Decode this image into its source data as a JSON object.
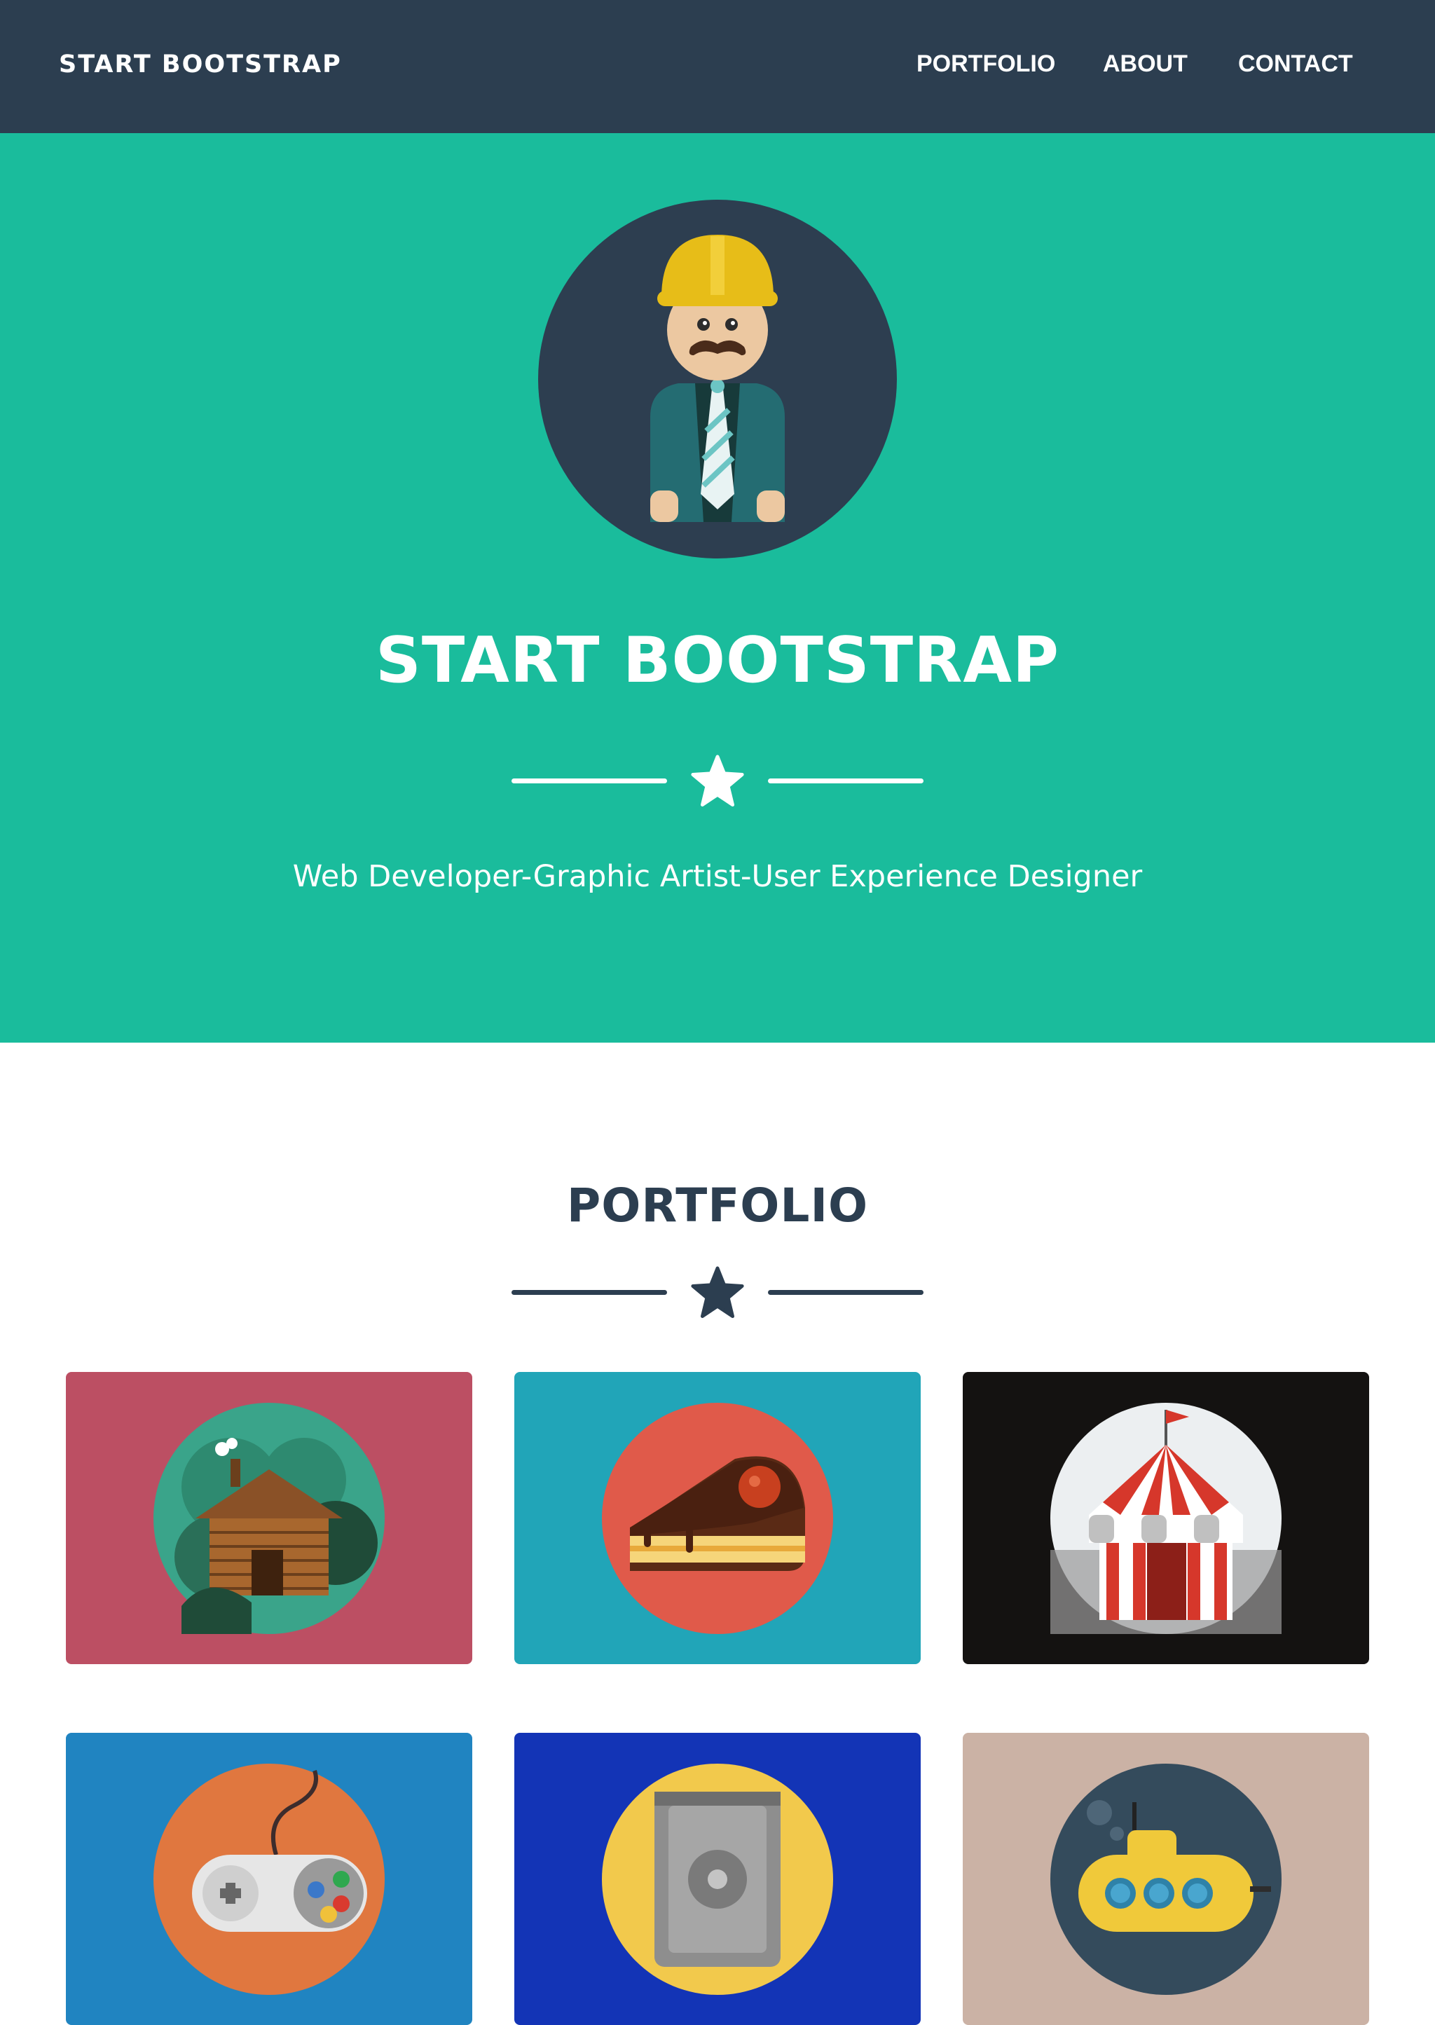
{
  "navbar": {
    "brand": "START BOOTSTRAP",
    "links": [
      "PORTFOLIO",
      "ABOUT",
      "CONTACT"
    ]
  },
  "hero": {
    "title": "START BOOTSTRAP",
    "subtitle": "Web Developer-Graphic Artist-User Experience Designer",
    "divider_icon": "star-icon"
  },
  "portfolio": {
    "title": "PORTFOLIO",
    "divider_icon": "star-icon",
    "items": [
      {
        "icon": "log-cabin-icon",
        "bg": "#bc4f63"
      },
      {
        "icon": "cake-slice-icon",
        "bg": "#21a5b8"
      },
      {
        "icon": "circus-tent-icon",
        "bg": "#141211"
      },
      {
        "icon": "game-controller-icon",
        "bg": "#2084c1"
      },
      {
        "icon": "safe-icon",
        "bg": "#1334b6"
      },
      {
        "icon": "submarine-icon",
        "bg": "#cbb2a5"
      }
    ]
  },
  "colors": {
    "navbar": "#2c3e50",
    "hero": "#1abc9c",
    "accent_dark": "#2c3e50",
    "white": "#ffffff"
  }
}
